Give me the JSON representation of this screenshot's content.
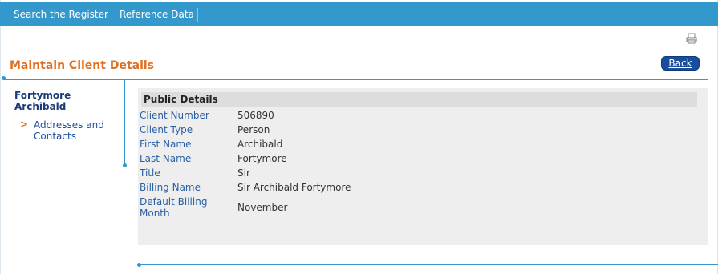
{
  "nav": {
    "items": [
      {
        "label": "Search the Register"
      },
      {
        "label": "Reference Data"
      }
    ]
  },
  "icons": {
    "print": "printer-icon"
  },
  "page": {
    "title": "Maintain Client Details",
    "back_label": "Back"
  },
  "sidebar": {
    "client_name": "Fortymore Archibald",
    "links": [
      {
        "label": "Addresses and Contacts"
      }
    ]
  },
  "details": {
    "section_title": "Public Details",
    "fields": [
      {
        "label": "Client Number",
        "value": "506890"
      },
      {
        "label": "Client Type",
        "value": "Person"
      },
      {
        "label": "First Name",
        "value": "Archibald"
      },
      {
        "label": "Last Name",
        "value": "Fortymore"
      },
      {
        "label": "Title",
        "value": "Sir"
      },
      {
        "label": "Billing Name",
        "value": "Sir Archibald Fortymore"
      },
      {
        "label": "Default Billing Month",
        "value": "November"
      }
    ]
  },
  "colors": {
    "nav_bar": "#3399cc",
    "title": "#e07020",
    "button": "#1a4e9c",
    "label": "#2a5fa6"
  }
}
